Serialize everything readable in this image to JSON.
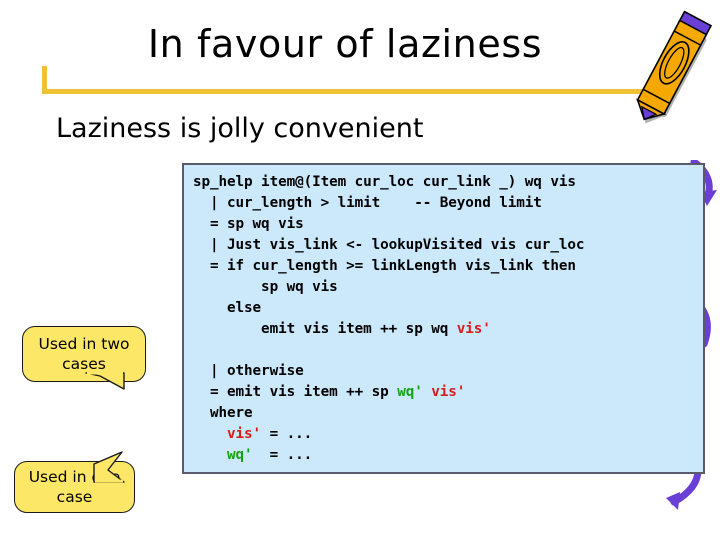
{
  "slide": {
    "title": "In favour of laziness",
    "subtitle": "Laziness is jolly convenient",
    "accent_rule_color": "#EFC135",
    "code_box_fill": "#CCE9FC",
    "code_box_border": "#5A5A6E",
    "callout_fill": "#FDE767",
    "keyword_red": "#D81B1B",
    "keyword_green": "#11A211",
    "crayon_body_color": "#F5A800",
    "crayon_tip_color": "#6A3FD6"
  },
  "code": {
    "language": "haskell",
    "lines": [
      "sp_help item@(Item cur_loc cur_link _) wq vis",
      "  | cur_length > limit    -- Beyond limit",
      "  = sp wq vis",
      "  | Just vis_link <- lookupVisited vis cur_loc",
      "  = if cur_length >= linkLength vis_link then",
      "        sp wq vis",
      "    else",
      "        emit vis item ++ sp wq vis'",
      "",
      "  | otherwise",
      "  = emit vis item ++ sp wq' vis'",
      "  where",
      "    vis' = ...",
      "    wq'  = ..."
    ],
    "plain": {
      "l1": "sp_help item@(Item cur_loc cur_link _) wq vis",
      "l2": "  | cur_length > limit    -- Beyond limit",
      "l3": "  = sp wq vis",
      "l4": "  | Just vis_link <- lookupVisited vis cur_loc",
      "l5": "  = if cur_length >= linkLength vis_link then",
      "l6": "        sp wq vis",
      "l7": "    else",
      "l8a": "        emit vis item ++ sp wq ",
      "l8b": "vis'",
      "l10": "  | otherwise",
      "l11a": "  = emit vis item ++ sp ",
      "l11b": "wq'",
      "l11c": " ",
      "l11d": "vis'",
      "l12": "  where",
      "l13a": "    ",
      "l13b": "vis'",
      "l13c": " = ...",
      "l14a": "    ",
      "l14b": "wq'",
      "l14c": "  = ..."
    }
  },
  "callouts": [
    {
      "id": "used-in-two-cases",
      "line1": "Used in two",
      "line2": "cases"
    },
    {
      "id": "used-in-one-case",
      "line1": "Used in one",
      "line2": "case"
    }
  ],
  "decorations": {
    "crayon": "crayon-icon",
    "arrows": [
      "purple-curved-arrow-top",
      "purple-curved-arrow-middle",
      "purple-curved-arrow-bottom"
    ]
  }
}
